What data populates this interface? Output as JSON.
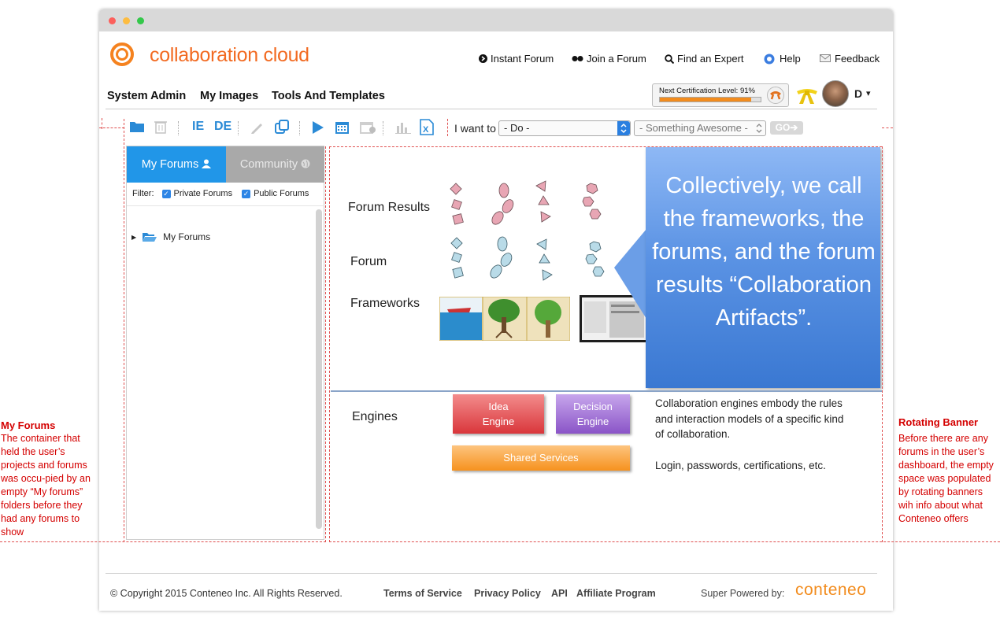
{
  "brand": {
    "logo_text": "collaboration cloud"
  },
  "top_nav": {
    "instant_forum": "Instant Forum",
    "join_forum": "Join a Forum",
    "find_expert": "Find an Expert",
    "help": "Help",
    "feedback": "Feedback"
  },
  "main_menu": {
    "system_admin": "System Admin",
    "my_images": "My Images",
    "tools_templates": "Tools And Templates"
  },
  "user": {
    "cert_label": "Next Certification Level: 91%",
    "cert_progress": 0.91,
    "initial": "D",
    "caret": "▾"
  },
  "toolbar": {
    "icons": [
      "folder-icon",
      "trash-icon",
      "ie-icon",
      "de-icon",
      "pencil-icon",
      "copy-icon",
      "play-icon",
      "calendar-icon",
      "calendar-people-icon",
      "bar-chart-icon",
      "excel-icon"
    ],
    "ie_label": "IE",
    "de_label": "DE",
    "i_want_to": "I want to",
    "do_value": "- Do -",
    "something_value": "- Something Awesome -",
    "go_label": "GO➔"
  },
  "forums_panel": {
    "tab_my": "My Forums",
    "tab_community": "Community",
    "filter_label": "Filter:",
    "private_label": "Private Forums",
    "public_label": "Public Forums",
    "tree_item": "My Forums"
  },
  "banner": {
    "forum_results": "Forum Results",
    "forum": "Forum",
    "frameworks": "Frameworks",
    "engines": "Engines",
    "callout": "Collectively, we call the frameworks, the forums, and the forum results “Collaboration Artifacts”.",
    "idea_engine": "Idea Engine",
    "decision_engine": "Decision Engine",
    "shared_services": "Shared Services",
    "engines_desc": "Collaboration engines embody the rules and interaction models of a specific kind of collaboration.",
    "login_desc": "Login, passwords, certifications, etc."
  },
  "annotations": {
    "left_title": "My Forums",
    "left_body": "The container that held the user’s projects and forums was occu-pied by an empty “My forums” folders before they had any forums to show",
    "right_title": "Rotating Banner",
    "right_body": "Before there are any forums in the user’s dashboard, the empty space was populated by rotating banners wih info about what Conteneo offers"
  },
  "footer": {
    "copyright": "© Copyright 2015 Conteneo Inc. All Rights Reserved.",
    "terms": "Terms of Service",
    "privacy": "Privacy Policy",
    "api": "API",
    "affiliate": "Affiliate Program",
    "powered": "Super Powered by:",
    "brand": "conteneo"
  },
  "colors": {
    "accent_blue": "#2196e8",
    "brand_orange": "#f26a21",
    "annotation_red": "#d40000"
  }
}
